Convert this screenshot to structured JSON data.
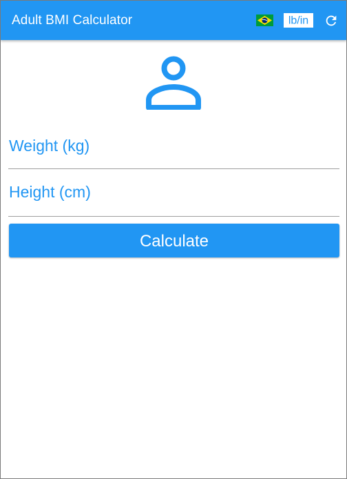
{
  "app": {
    "title": "Adult BMI Calculator"
  },
  "toolbar": {
    "language_icon": "brazil-flag-icon",
    "unit_toggle_label": "lb/in",
    "refresh_icon": "refresh-icon"
  },
  "form": {
    "avatar_icon": "person-outline-icon",
    "weight": {
      "placeholder": "Weight (kg)",
      "value": ""
    },
    "height": {
      "placeholder": "Height (cm)",
      "value": ""
    },
    "calculate_label": "Calculate"
  },
  "colors": {
    "primary": "#2196f3",
    "on_primary": "#ffffff",
    "divider": "#9e9e9e"
  }
}
